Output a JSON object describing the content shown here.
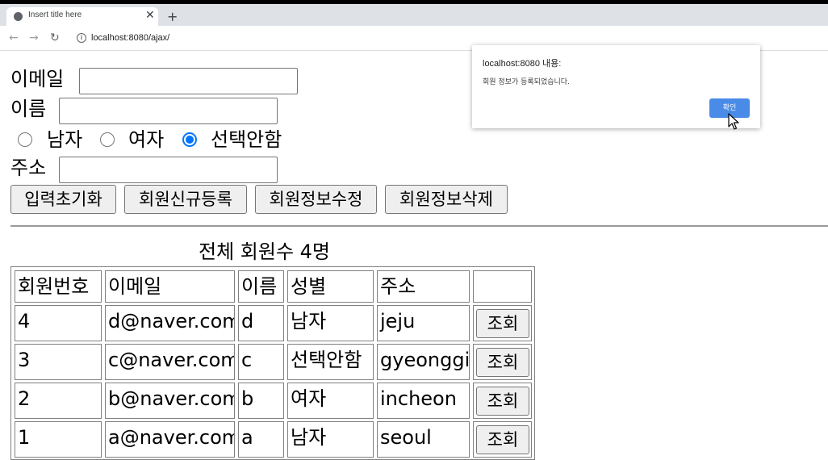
{
  "browser": {
    "tab_title": "Insert title here",
    "url": "localhost:8080/ajax/",
    "icons": {
      "favicon": "globe-icon",
      "close": "close-icon",
      "new_tab": "plus-icon",
      "back": "arrow-left-icon",
      "forward": "arrow-right-icon",
      "reload": "reload-icon",
      "site_info": "info-icon"
    }
  },
  "form": {
    "email_label": "이메일",
    "email_value": "",
    "name_label": "이름",
    "name_value": "",
    "gender_options": [
      "남자",
      "여자",
      "선택안함"
    ],
    "gender_selected": "선택안함",
    "address_label": "주소",
    "address_value": ""
  },
  "buttons": {
    "reset": "입력초기화",
    "register": "회원신규등록",
    "update": "회원정보수정",
    "delete": "회원정보삭제"
  },
  "member_count_text": "전체 회원수 4명",
  "table": {
    "headers": [
      "회원번호",
      "이메일",
      "이름",
      "성별",
      "주소",
      ""
    ],
    "view_button": "조회",
    "rows": [
      {
        "id": "4",
        "email": "d@naver.com",
        "name": "d",
        "gender": "남자",
        "address": "jeju"
      },
      {
        "id": "3",
        "email": "c@naver.com",
        "name": "c",
        "gender": "선택안함",
        "address": "gyeonggi"
      },
      {
        "id": "2",
        "email": "b@naver.com",
        "name": "b",
        "gender": "여자",
        "address": "incheon"
      },
      {
        "id": "1",
        "email": "a@naver.com",
        "name": "a",
        "gender": "남자",
        "address": "seoul"
      }
    ]
  },
  "dialog": {
    "title": "localhost:8080 내용:",
    "message": "회원 정보가 등록되었습니다.",
    "ok_label": "확인"
  },
  "colors": {
    "accent": "#0075ff",
    "dialog_button": "#4a8be7"
  }
}
